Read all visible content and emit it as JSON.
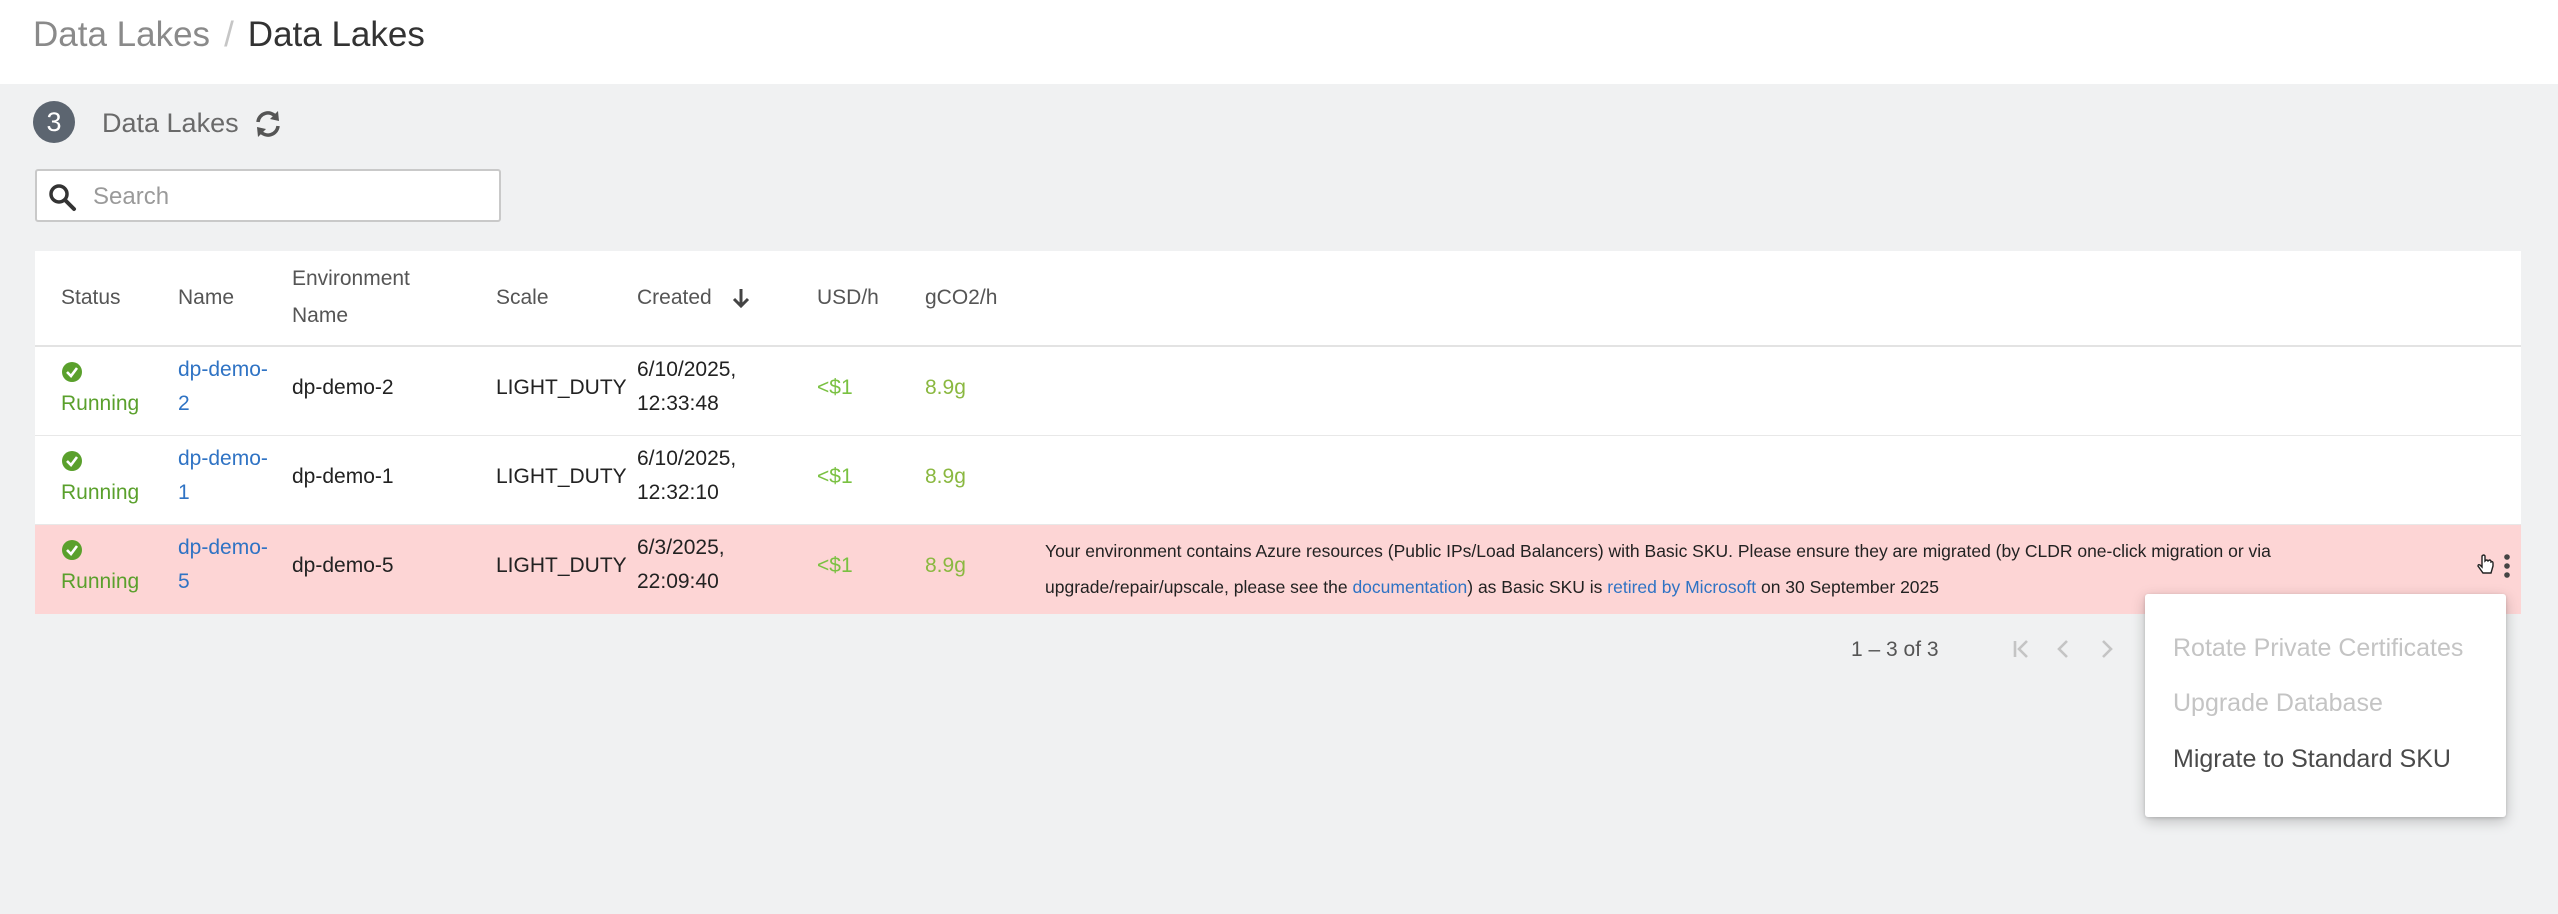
{
  "breadcrumb": {
    "parent": "Data Lakes",
    "separator": "/",
    "current": "Data Lakes"
  },
  "section": {
    "count": "3",
    "title": "Data Lakes"
  },
  "search": {
    "placeholder": "Search",
    "value": ""
  },
  "table": {
    "columns": {
      "status": "Status",
      "name": "Name",
      "environment_name": "Environment Name",
      "scale": "Scale",
      "created": "Created",
      "usd": "USD/h",
      "co2": "gCO2/h"
    },
    "sort": {
      "column": "Created",
      "direction": "descending"
    },
    "rows": [
      {
        "status": "Running",
        "name": "dp-demo-2",
        "environment": "dp-demo-2",
        "scale": "LIGHT_DUTY",
        "created": "6/10/2025, 12:33:48",
        "usd": "<$1",
        "co2": "8.9g"
      },
      {
        "status": "Running",
        "name": "dp-demo-1",
        "environment": "dp-demo-1",
        "scale": "LIGHT_DUTY",
        "created": "6/10/2025, 12:32:10",
        "usd": "<$1",
        "co2": "8.9g"
      },
      {
        "status": "Running",
        "name": "dp-demo-5",
        "environment": "dp-demo-5",
        "scale": "LIGHT_DUTY",
        "created": "6/3/2025, 22:09:40",
        "usd": "<$1",
        "co2": "8.9g",
        "warning": {
          "part1": "Your environment contains Azure resources (Public IPs/Load Balancers) with Basic SKU. Please ensure they are migrated (by CLDR one-click migration or via upgrade/repair/upscale, please see the ",
          "link1": "documentation",
          "part2": ") as Basic SKU is ",
          "link2": "retired by Microsoft",
          "part3": " on 30 September 2025"
        }
      }
    ]
  },
  "pagination": {
    "range": "1 – 3 of 3"
  },
  "actions_menu": {
    "items": [
      {
        "label": "Rotate Private Certificates",
        "enabled": false
      },
      {
        "label": "Upgrade Database",
        "enabled": false
      },
      {
        "label": "Migrate to Standard SKU",
        "enabled": true
      }
    ]
  },
  "colors": {
    "running": "#5aa02c",
    "link": "#2f73c4",
    "warning_row": "#fdd5d5",
    "usd": "#7ac142",
    "co2": "#8ab840",
    "badge": "#5c6570"
  },
  "icons": [
    "refresh-icon",
    "search-icon",
    "sort-arrow-down-icon",
    "check-circle-icon",
    "cursor-hand-icon",
    "kebab-menu-icon",
    "first-page-icon",
    "previous-page-icon",
    "next-page-icon"
  ]
}
